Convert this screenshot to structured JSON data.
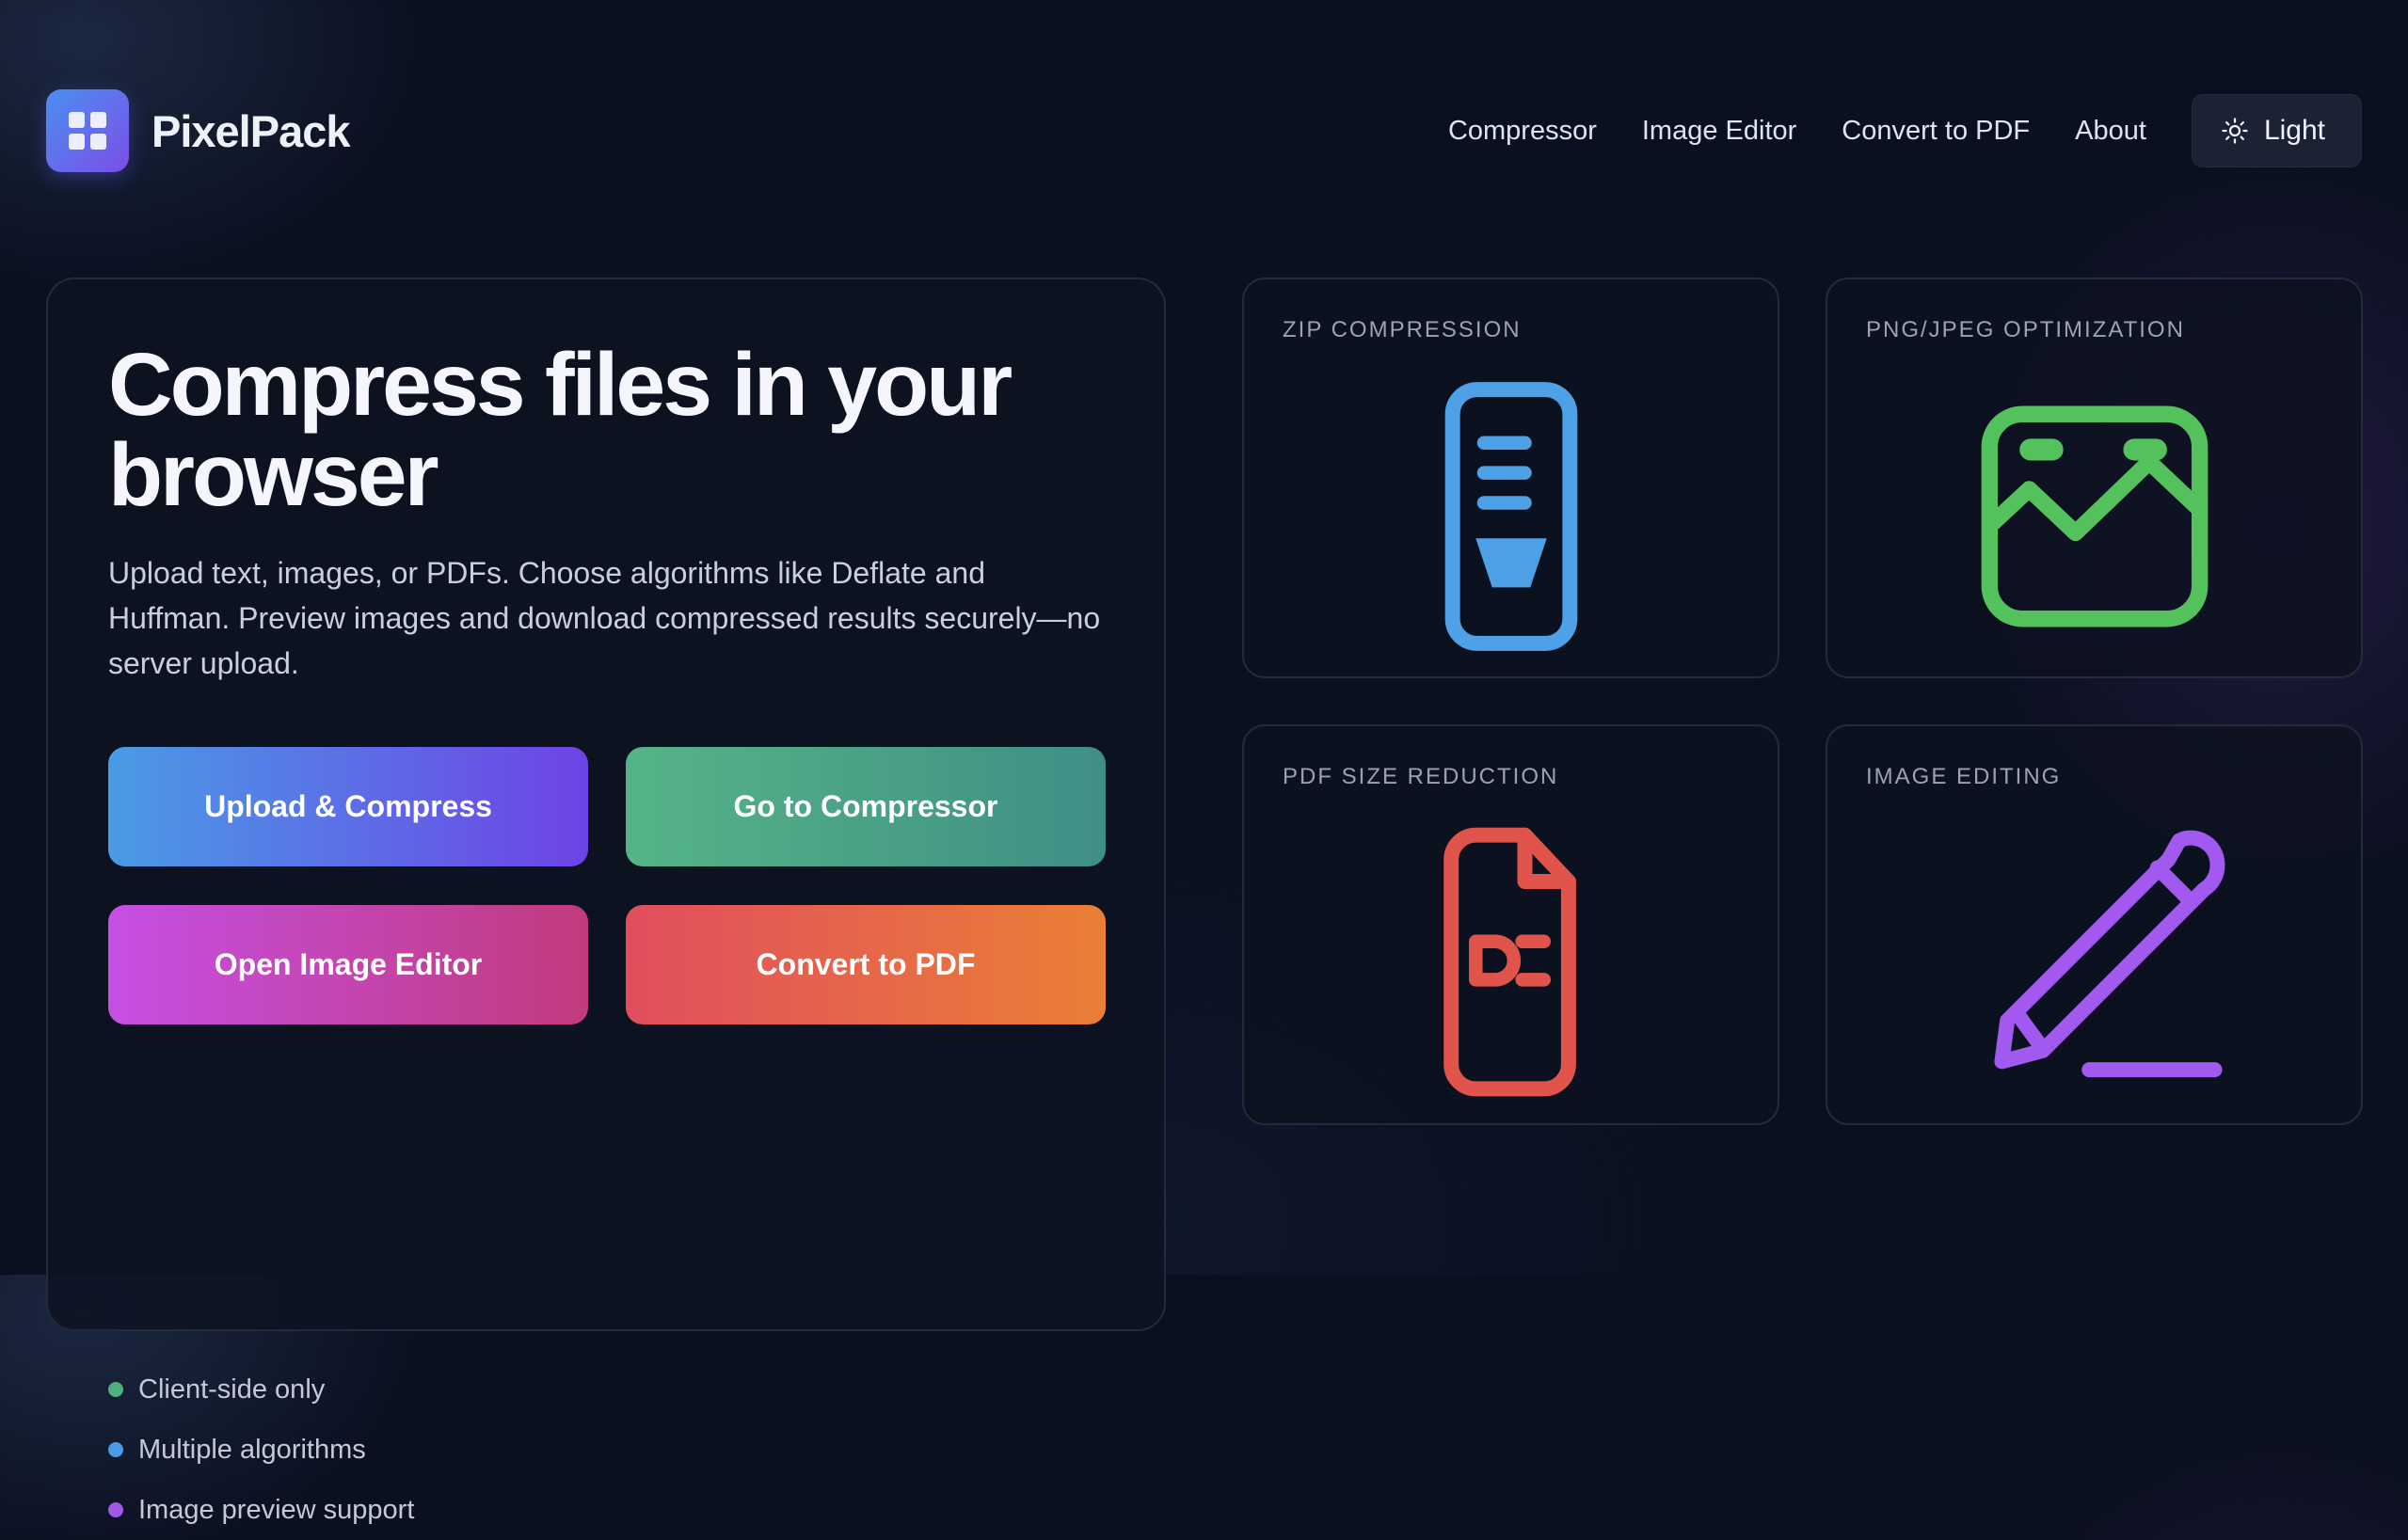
{
  "header": {
    "brand": "PixelPack",
    "nav": [
      "Compressor",
      "Image Editor",
      "Convert to PDF",
      "About"
    ],
    "theme_toggle": "Light"
  },
  "hero": {
    "title": "Compress files in your browser",
    "description": "Upload text, images, or PDFs. Choose algorithms like Deflate and Huffman. Preview images and download compressed results securely—no server upload.",
    "buttons": {
      "upload": "Upload & Compress",
      "goto": "Go to Compressor",
      "editor": "Open Image Editor",
      "pdf": "Convert to PDF"
    },
    "features": [
      {
        "label": "Client-side only",
        "color": "#4fb07e"
      },
      {
        "label": "Multiple algorithms",
        "color": "#4a9be6"
      },
      {
        "label": "Image preview support",
        "color": "#a259e6"
      }
    ]
  },
  "tiles": [
    {
      "label": "ZIP COMPRESSION",
      "icon": "zip-file-icon",
      "color": "#4ea1e6"
    },
    {
      "label": "PNG/JPEG OPTIMIZATION",
      "icon": "image-icon",
      "color": "#53c25c"
    },
    {
      "label": "PDF SIZE REDUCTION",
      "icon": "pdf-file-icon",
      "color": "#e0544c"
    },
    {
      "label": "IMAGE EDITING",
      "icon": "pencil-icon",
      "color": "#a259f0"
    }
  ]
}
